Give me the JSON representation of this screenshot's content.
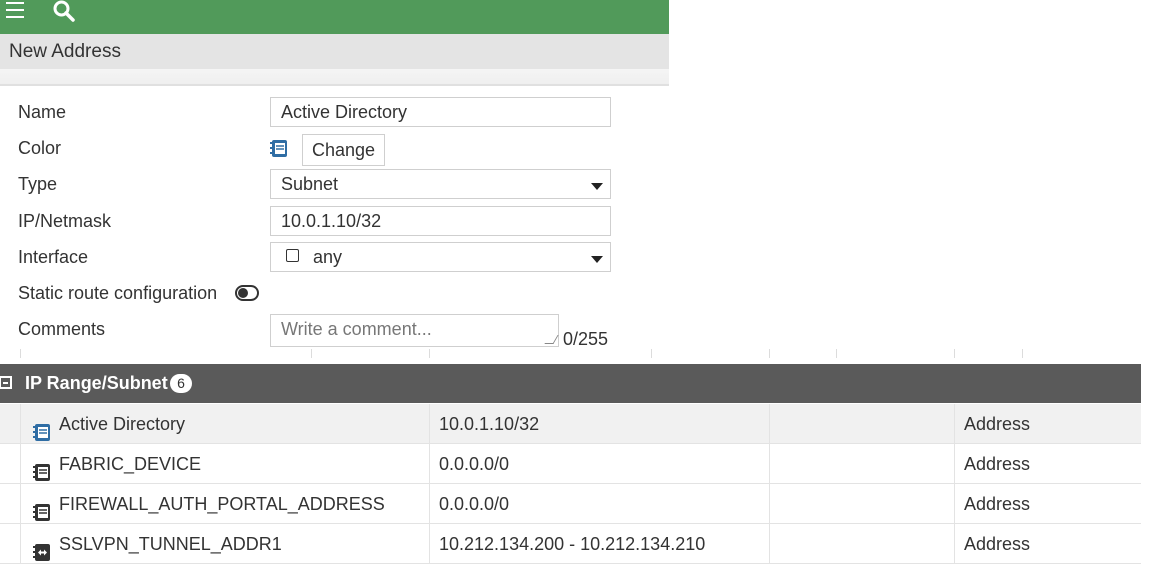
{
  "topbar": {
    "menu_icon": "hamburger-icon",
    "search_icon": "search-icon",
    "color": "#519a5a"
  },
  "dialog_title": "New Address",
  "form": {
    "name_label": "Name",
    "name_value": "Active Directory",
    "color_label": "Color",
    "change_label": "Change",
    "type_label": "Type",
    "type_value": "Subnet",
    "ip_label": "IP/Netmask",
    "ip_value": "10.0.1.10/32",
    "interface_label": "Interface",
    "interface_value": "any",
    "static_route_label": "Static route configuration",
    "static_route_enabled": false,
    "comments_label": "Comments",
    "comments_placeholder": "Write a comment...",
    "comments_counter": "0/255"
  },
  "group": {
    "title": "IP Range/Subnet",
    "count": "6",
    "header_color": "#5a5a5a"
  },
  "rows": [
    {
      "name": "Active Directory",
      "value": "10.0.1.10/32",
      "type": "Address",
      "icon": "address-icon-blue",
      "selected": true
    },
    {
      "name": "FABRIC_DEVICE",
      "value": "0.0.0.0/0",
      "type": "Address",
      "icon": "address-icon"
    },
    {
      "name": "FIREWALL_AUTH_PORTAL_ADDRESS",
      "value": "0.0.0.0/0",
      "type": "Address",
      "icon": "address-icon"
    },
    {
      "name": "SSLVPN_TUNNEL_ADDR1",
      "value": "10.212.134.200 - 10.212.134.210",
      "type": "Address",
      "icon": "iprange-icon"
    }
  ]
}
